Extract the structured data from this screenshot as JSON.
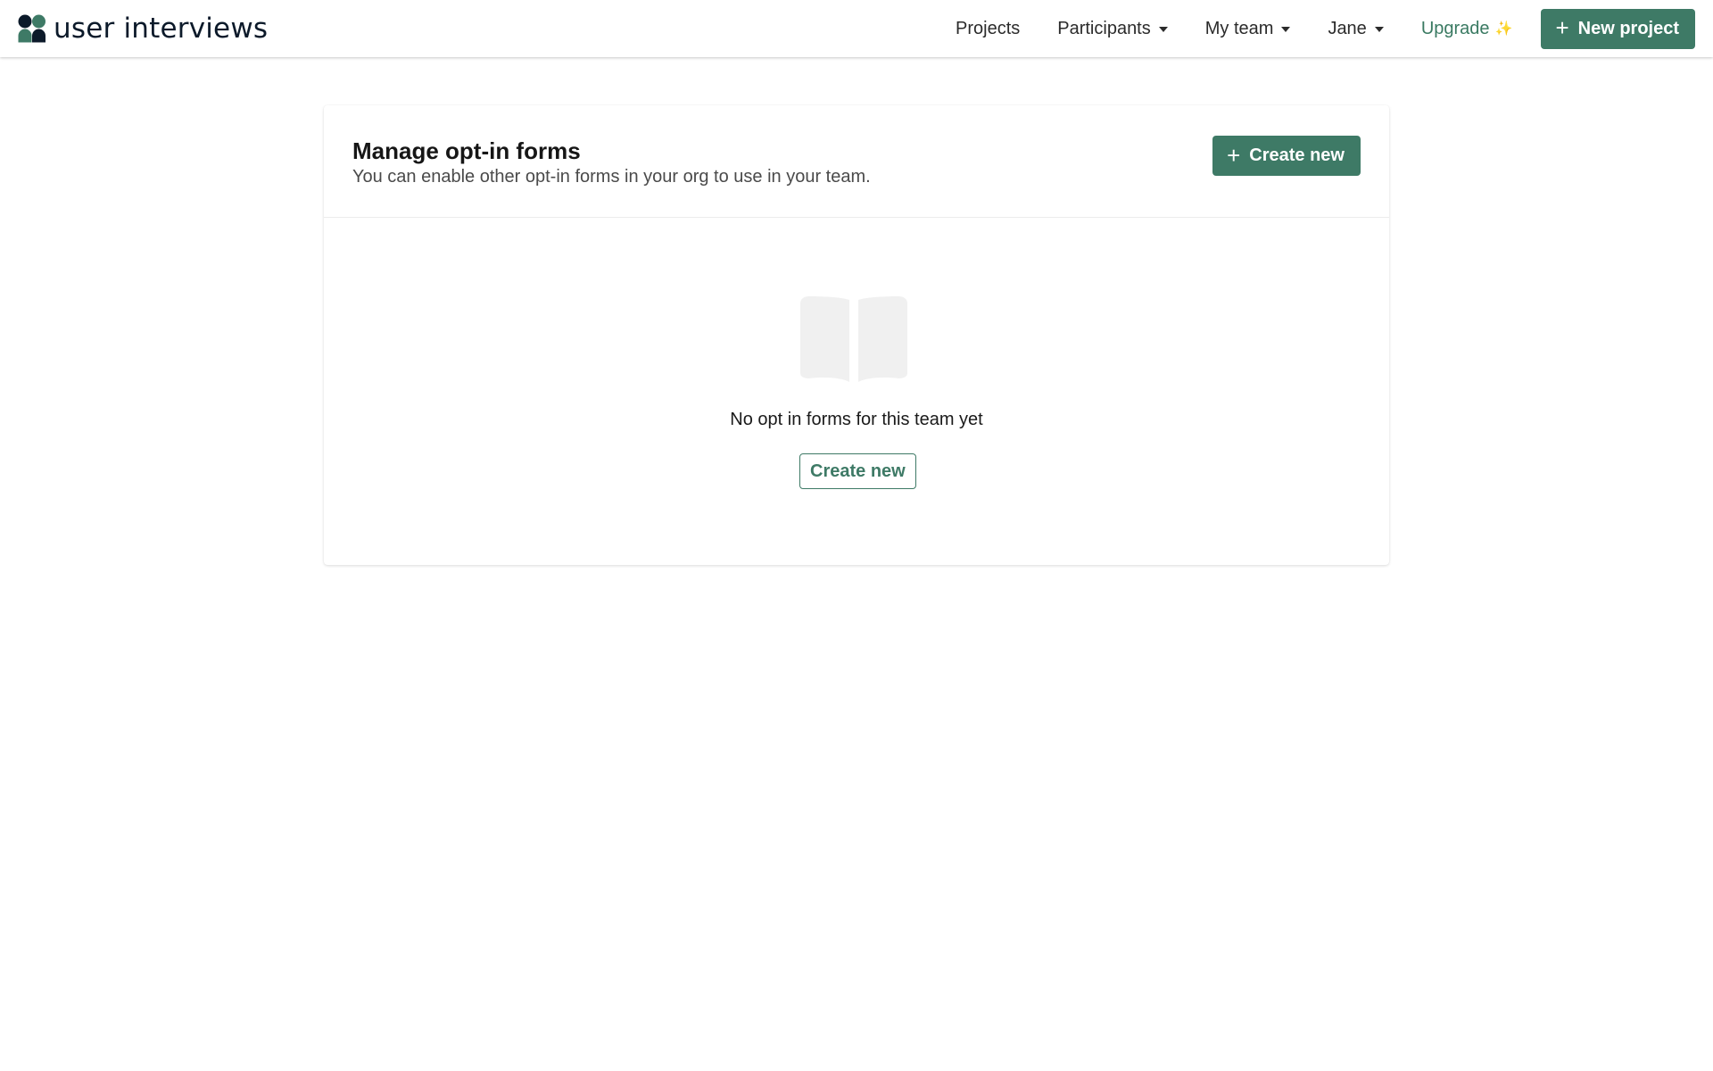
{
  "brand": {
    "name": "user interviews",
    "icon": "user-interviews-logo-icon"
  },
  "nav": {
    "items": [
      {
        "label": "Projects",
        "dropdown": false
      },
      {
        "label": "Participants",
        "dropdown": true
      },
      {
        "label": "My team",
        "dropdown": true
      },
      {
        "label": "Jane",
        "dropdown": true
      }
    ],
    "upgrade_label": "Upgrade",
    "upgrade_icon": "sparkle-icon",
    "new_project_label": "New project"
  },
  "card": {
    "title": "Manage opt-in forms",
    "subtitle": "You can enable other opt-in forms in your org to use in your team.",
    "create_label": "Create new"
  },
  "empty_state": {
    "icon": "open-book-icon",
    "message": "No opt in forms for this team yet",
    "create_label": "Create new"
  },
  "colors": {
    "primary": "#3e7a66",
    "upgrade_text": "#3a7a62",
    "sparkle": "#f0c24a",
    "icon_placeholder": "#f0f0f0"
  }
}
